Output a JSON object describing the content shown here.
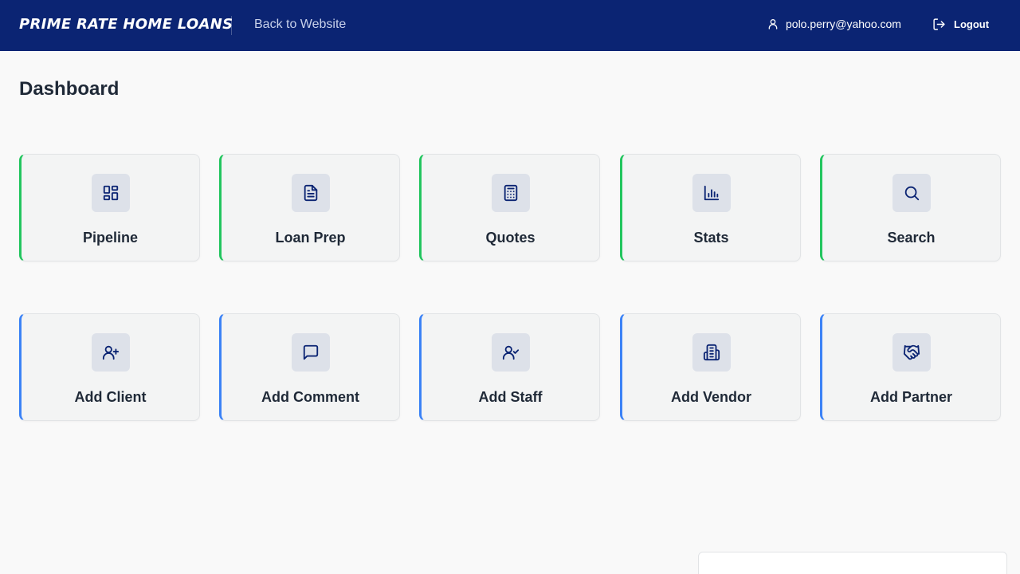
{
  "header": {
    "brand": "PRIME RATE HOME LOANS",
    "back_link": "Back to Website",
    "user_email": "polo.perry@yahoo.com",
    "logout_label": "Logout",
    "background_color": "#0b2473"
  },
  "page": {
    "title": "Dashboard"
  },
  "cards_row1": [
    {
      "label": "Pipeline",
      "icon": "layout-grid-icon"
    },
    {
      "label": "Loan Prep",
      "icon": "document-icon"
    },
    {
      "label": "Quotes",
      "icon": "calculator-icon"
    },
    {
      "label": "Stats",
      "icon": "bar-chart-icon"
    },
    {
      "label": "Search",
      "icon": "search-icon"
    }
  ],
  "cards_row2": [
    {
      "label": "Add Client",
      "icon": "user-plus-icon"
    },
    {
      "label": "Add Comment",
      "icon": "message-square-icon"
    },
    {
      "label": "Add Staff",
      "icon": "user-check-icon"
    },
    {
      "label": "Add Vendor",
      "icon": "building-icon"
    },
    {
      "label": "Add Partner",
      "icon": "handshake-icon"
    }
  ],
  "colors": {
    "row1_accent": "#22c55e",
    "row2_accent": "#3b82f6",
    "icon_color": "#0b2473"
  }
}
